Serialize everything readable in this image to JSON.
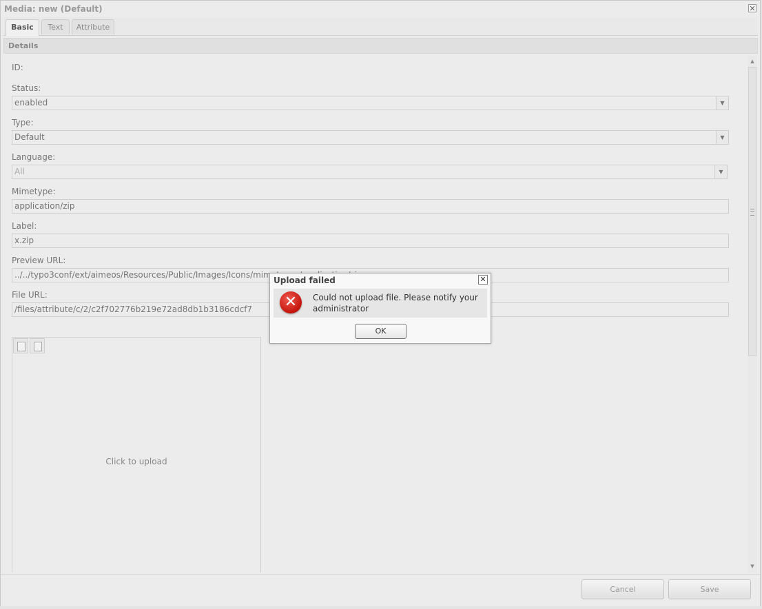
{
  "window": {
    "title": "Media: new (Default)",
    "close_glyph": "✕"
  },
  "tabs": [
    {
      "label": "Basic",
      "active": true
    },
    {
      "label": "Text",
      "active": false
    },
    {
      "label": "Attribute",
      "active": false
    }
  ],
  "section": {
    "title": "Details"
  },
  "form": {
    "id_label": "ID:",
    "status": {
      "label": "Status:",
      "value": "enabled"
    },
    "type": {
      "label": "Type:",
      "value": "Default"
    },
    "language": {
      "label": "Language:",
      "value": "All",
      "disabled": true
    },
    "mimetype": {
      "label": "Mimetype:",
      "value": "application/zip"
    },
    "label": {
      "label": "Label:",
      "value": "x.zip"
    },
    "preview_url": {
      "label": "Preview URL:",
      "value": "../../typo3conf/ext/aimeos/Resources/Public/Images/Icons/mimetypes/application/zip.png"
    },
    "file_url": {
      "label": "File URL:",
      "value": "/files/attribute/c/2/c2f702776b219e72ad8db1b3186cdcf7"
    },
    "dropdown_glyph": "▼"
  },
  "upload": {
    "text": "Click to upload",
    "buttons": [
      {
        "icon": "document-icon"
      },
      {
        "icon": "document-icon"
      }
    ]
  },
  "footer": {
    "cancel_label": "Cancel",
    "save_label": "Save"
  },
  "dialog": {
    "title": "Upload failed",
    "close_glyph": "✕",
    "icon": "error-icon",
    "icon_glyph": "✕",
    "message": "Could not upload file. Please notify your administrator",
    "ok_label": "OK"
  },
  "colors": {
    "error_red": "#d3201a",
    "background": "#ececec"
  }
}
